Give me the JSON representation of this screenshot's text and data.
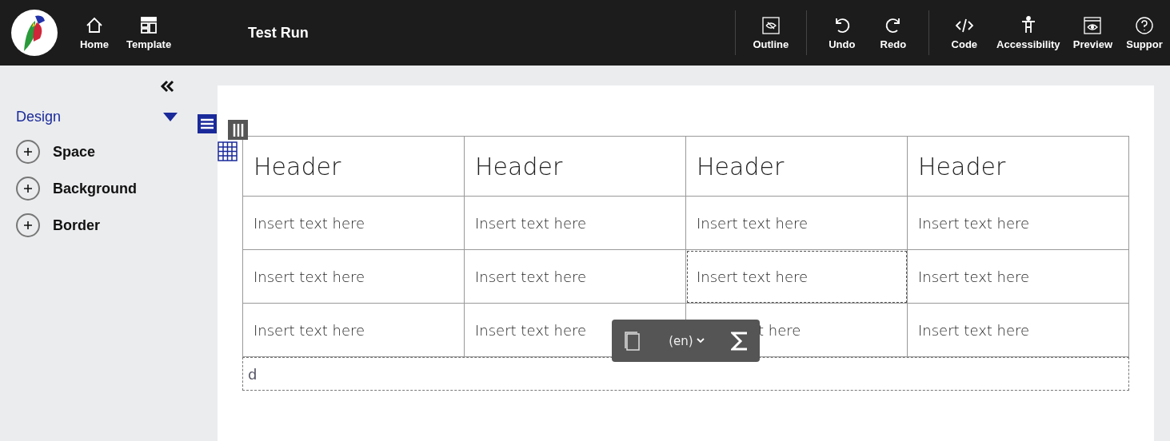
{
  "toolbar": {
    "left": [
      {
        "kind": "home",
        "label": "Home"
      },
      {
        "kind": "template",
        "label": "Template"
      }
    ],
    "title": "Test Run",
    "groups": [
      [
        {
          "kind": "outline",
          "label": "Outline"
        }
      ],
      [
        {
          "kind": "undo",
          "label": "Undo"
        },
        {
          "kind": "redo",
          "label": "Redo"
        }
      ],
      [
        {
          "kind": "code",
          "label": "Code"
        },
        {
          "kind": "accessibility",
          "label": "Accessibility"
        },
        {
          "kind": "preview",
          "label": "Preview"
        },
        {
          "kind": "support",
          "label": "Suppor"
        }
      ]
    ]
  },
  "sidebar": {
    "section": "Design",
    "expanded": true,
    "items": [
      {
        "label": "Space",
        "expanded": false
      },
      {
        "label": "Background",
        "expanded": false
      },
      {
        "label": "Border",
        "expanded": false
      }
    ]
  },
  "table": {
    "headers": [
      "Header",
      "Header",
      "Header",
      "Header"
    ],
    "rows": [
      [
        {
          "text": "Insert text here",
          "selected": false
        },
        {
          "text": "Insert text here",
          "selected": false
        },
        {
          "text": "Insert text here",
          "selected": false
        },
        {
          "text": "Insert text here",
          "selected": false
        }
      ],
      [
        {
          "text": "Insert text here",
          "selected": false
        },
        {
          "text": "Insert text here",
          "selected": false
        },
        {
          "text": "Insert text here",
          "selected": true
        },
        {
          "text": "Insert text here",
          "selected": false
        }
      ],
      [
        {
          "text": "Insert text here",
          "selected": false
        },
        {
          "text": "Insert text here",
          "selected": false
        },
        {
          "text": "t here",
          "selected": false,
          "covered": true
        },
        {
          "text": "Insert text here",
          "selected": false
        }
      ]
    ]
  },
  "paragraph": "d",
  "float_toolbar": {
    "language": "(en)"
  }
}
